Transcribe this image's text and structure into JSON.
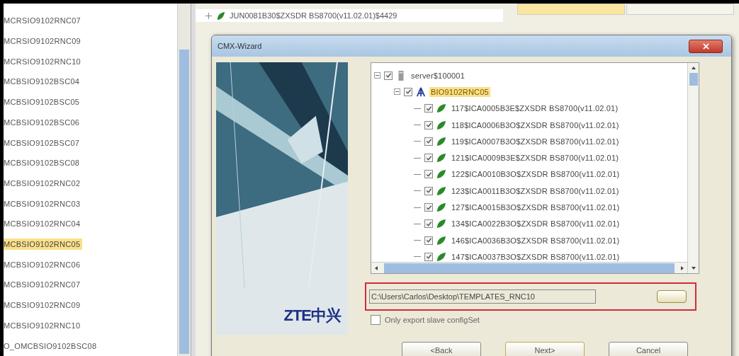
{
  "background_list": {
    "items": [
      {
        "label": "MCRSIO9102RNC07",
        "selected": false
      },
      {
        "label": "MCRSIO9102RNC09",
        "selected": false
      },
      {
        "label": "MCRSIO9102RNC10",
        "selected": false
      },
      {
        "label": "MCBSIO9102BSC04",
        "selected": false
      },
      {
        "label": "MCBSIO9102BSC05",
        "selected": false
      },
      {
        "label": "MCBSIO9102BSC06",
        "selected": false
      },
      {
        "label": "MCBSIO9102BSC07",
        "selected": false
      },
      {
        "label": "MCBSIO9102BSC08",
        "selected": false
      },
      {
        "label": "MCBSIO9102RNC02",
        "selected": false
      },
      {
        "label": "MCBSIO9102RNC03",
        "selected": false
      },
      {
        "label": "MCBSIO9102RNC04",
        "selected": false
      },
      {
        "label": "MCBSIO9102RNC05",
        "selected": true
      },
      {
        "label": "MCBSIO9102RNC06",
        "selected": false
      },
      {
        "label": "MCBSIO9102RNC07",
        "selected": false
      },
      {
        "label": "MCBSIO9102RNC09",
        "selected": false
      },
      {
        "label": "MCBSIO9102RNC10",
        "selected": false
      },
      {
        "label": "O_OMCBSIO9102BSC08",
        "selected": false
      }
    ]
  },
  "background_tree": {
    "items": [
      {
        "label": "JUN0081B30$ZXSDR BS8700(v11.02.01)$4429"
      }
    ]
  },
  "dialog": {
    "title": "CMX-Wizard",
    "logo_text": "ZTE中兴",
    "tree": [
      {
        "label": "server$100001",
        "kind": "server",
        "checked": true,
        "expanded": true,
        "selected": false,
        "children": [
          {
            "label": "BIO9102RNC05",
            "kind": "network",
            "checked": true,
            "expanded": true,
            "selected": true,
            "children": [
              {
                "label": "117$ICA0005B3E$ZXSDR BS8700(v11.02.01)",
                "kind": "leaf",
                "checked": true,
                "selected": false
              },
              {
                "label": "118$ICA0006B3O$ZXSDR BS8700(v11.02.01)",
                "kind": "leaf",
                "checked": true,
                "selected": false
              },
              {
                "label": "119$ICA0007B3O$ZXSDR BS8700(v11.02.01)",
                "kind": "leaf",
                "checked": true,
                "selected": false
              },
              {
                "label": "121$ICA0009B3E$ZXSDR BS8700(v11.02.01)",
                "kind": "leaf",
                "checked": true,
                "selected": false
              },
              {
                "label": "122$ICA0010B3O$ZXSDR BS8700(v11.02.01)",
                "kind": "leaf",
                "checked": true,
                "selected": false
              },
              {
                "label": "123$ICA0011B3O$ZXSDR BS8700(v11.02.01)",
                "kind": "leaf",
                "checked": true,
                "selected": false
              },
              {
                "label": "127$ICA0015B3O$ZXSDR BS8700(v11.02.01)",
                "kind": "leaf",
                "checked": true,
                "selected": false
              },
              {
                "label": "134$ICA0022B3O$ZXSDR BS8700(v11.02.01)",
                "kind": "leaf",
                "checked": true,
                "selected": false
              },
              {
                "label": "146$ICA0036B3O$ZXSDR BS8700(v11.02.01)",
                "kind": "leaf",
                "checked": true,
                "selected": false
              },
              {
                "label": "147$ICA0037B3O$ZXSDR BS8700(v11.02.01)",
                "kind": "leaf",
                "checked": true,
                "selected": false
              }
            ]
          }
        ]
      }
    ],
    "path_field": {
      "value": "C:\\Users\\Carlos\\Desktop\\TEMPLATES_RNC10"
    },
    "slave_option": {
      "label": "Only export slave configSet",
      "checked": false
    },
    "buttons": [
      {
        "label": "<Back",
        "default": false
      },
      {
        "label": "Next>",
        "default": true
      },
      {
        "label": "Cancel",
        "default": false
      }
    ]
  }
}
